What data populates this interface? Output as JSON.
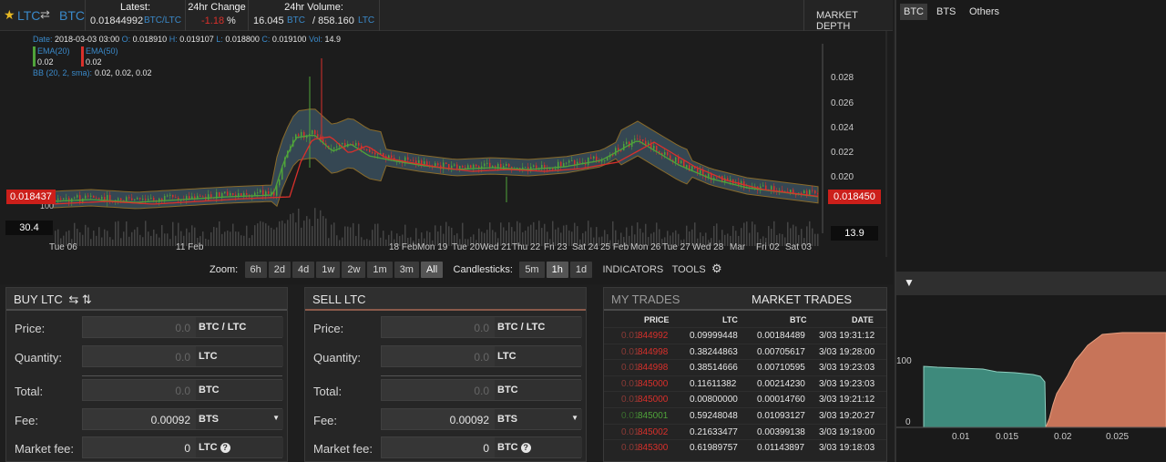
{
  "header": {
    "pair_base": "LTC",
    "pair_quote": "BTC",
    "latest_label": "Latest:",
    "latest_value": "0.01844992",
    "latest_pair": "BTC/LTC",
    "change_label": "24hr Change",
    "change_value": "-1.18",
    "change_unit": "%",
    "volume_label": "24hr Volume:",
    "volume_ltc": "16.045",
    "volume_btc_unit": "BTC",
    "volume_btc": "/ 858.160",
    "volume_ltc_unit": "LTC",
    "market_depth": "MARKET DEPTH"
  },
  "chart": {
    "ohlc_line": {
      "date_label": "Date:",
      "date": "2018-03-03 03:00",
      "o_label": "O:",
      "o": "0.018910",
      "h_label": "H:",
      "h": "0.019107",
      "l_label": "L:",
      "l": "0.018800",
      "c_label": "C:",
      "c": "0.019100",
      "vol_label": "Vol:",
      "vol": "14.9"
    },
    "ema20_label": "EMA(20)",
    "ema20_value": "0.02",
    "ema50_label": "EMA(50)",
    "ema50_value": "0.02",
    "bb_label": "BB (20, 2, sma):",
    "bb_value": "0.02, 0.02, 0.02",
    "price_left": "0.018437",
    "price_right": "0.018450",
    "vol_left": "30.4",
    "vol_right": "13.9",
    "vol_axis_100": "100",
    "y_ticks": [
      "0.028",
      "0.026",
      "0.024",
      "0.022",
      "0.020"
    ],
    "x_ticks": [
      "Tue 06",
      "11 Feb",
      "18 Feb",
      "Mon 19",
      "Tue 20",
      "Wed 21",
      "Thu 22",
      "Fri 23",
      "Sat 24",
      "25 Feb",
      "Mon 26",
      "Tue 27",
      "Wed 28",
      "Mar",
      "Fri 02",
      "Sat 03"
    ],
    "colors": {
      "up": "#4fa33a",
      "down": "#d9302b",
      "band": "#3d5566",
      "ema": "#e0a020"
    }
  },
  "controls": {
    "zoom_label": "Zoom:",
    "zoom": [
      "6h",
      "2d",
      "4d",
      "1w",
      "2w",
      "1m",
      "3m",
      "All"
    ],
    "zoom_selected": "All",
    "candle_label": "Candlesticks:",
    "candles": [
      "5m",
      "1h",
      "1d"
    ],
    "candle_selected": "1h",
    "indicators": "INDICATORS",
    "tools": "TOOLS"
  },
  "buy": {
    "title": "BUY LTC",
    "price_label": "Price:",
    "price_value": "0.0",
    "price_unit": "BTC / LTC",
    "qty_label": "Quantity:",
    "qty_value": "0.0",
    "qty_unit": "LTC",
    "total_label": "Total:",
    "total_value": "0.0",
    "total_unit": "BTC",
    "fee_label": "Fee:",
    "fee_value": "0.00092",
    "fee_unit": "BTS",
    "mfee_label": "Market fee:",
    "mfee_value": "0",
    "mfee_unit": "LTC"
  },
  "sell": {
    "title": "SELL LTC",
    "price_label": "Price:",
    "price_value": "0.0",
    "price_unit": "BTC / LTC",
    "qty_label": "Quantity:",
    "qty_value": "0.0",
    "qty_unit": "LTC",
    "total_label": "Total:",
    "total_value": "0.0",
    "total_unit": "BTC",
    "fee_label": "Fee:",
    "fee_value": "0.00092",
    "fee_unit": "BTS",
    "mfee_label": "Market fee:",
    "mfee_value": "0",
    "mfee_unit": "BTC"
  },
  "trades": {
    "tab_my": "MY TRADES",
    "tab_market": "MARKET TRADES",
    "col_price": "PRICE",
    "col_ltc": "LTC",
    "col_btc": "BTC",
    "col_date": "DATE",
    "rows": [
      {
        "p1": "0.01",
        "p2": "844992",
        "c": "red",
        "ltc": "0.09999448",
        "btc": "0.00184489",
        "date": "3/03 19:31:12"
      },
      {
        "p1": "0.01",
        "p2": "844998",
        "c": "red",
        "ltc": "0.38244863",
        "btc": "0.00705617",
        "date": "3/03 19:28:00"
      },
      {
        "p1": "0.01",
        "p2": "844998",
        "c": "red",
        "ltc": "0.38514666",
        "btc": "0.00710595",
        "date": "3/03 19:23:03"
      },
      {
        "p1": "0.01",
        "p2": "845000",
        "c": "red",
        "ltc": "0.11611382",
        "btc": "0.00214230",
        "date": "3/03 19:23:03"
      },
      {
        "p1": "0.01",
        "p2": "845000",
        "c": "red",
        "ltc": "0.00800000",
        "btc": "0.00014760",
        "date": "3/03 19:21:12"
      },
      {
        "p1": "0.01",
        "p2": "845001",
        "c": "green",
        "ltc": "0.59248048",
        "btc": "0.01093127",
        "date": "3/03 19:20:27"
      },
      {
        "p1": "0.01",
        "p2": "845002",
        "c": "red",
        "ltc": "0.21633477",
        "btc": "0.00399138",
        "date": "3/03 19:19:00"
      },
      {
        "p1": "0.01",
        "p2": "845300",
        "c": "red",
        "ltc": "0.61989757",
        "btc": "0.01143897",
        "date": "3/03 19:18:03"
      }
    ]
  },
  "right": {
    "tabs": [
      "BTC",
      "BTS",
      "Others"
    ],
    "selected_tab": "BTC",
    "depth_y": [
      "100",
      "0"
    ],
    "depth_x": [
      "0.01",
      "0.015",
      "0.02",
      "0.025"
    ],
    "bid_color": "#3e8a7c",
    "ask_color": "#c77459"
  }
}
